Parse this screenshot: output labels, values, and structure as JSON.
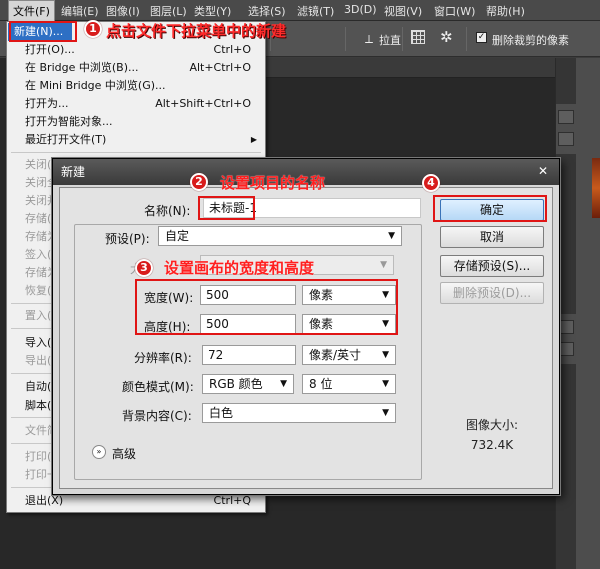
{
  "menubar": {
    "items": [
      "文件(F)",
      "编辑(E)",
      "图像(I)",
      "图层(L)",
      "类型(Y)",
      "选择(S)",
      "滤镜(T)",
      "3D(D)",
      "视图(V)",
      "窗口(W)",
      "帮助(H)"
    ]
  },
  "optbar": {
    "straighten_label": "拉直",
    "delete_cropped_label": "删除裁剪的像素"
  },
  "file_menu": {
    "items": [
      {
        "label": "新建(N)...",
        "shortcut": "",
        "state": "highlight"
      },
      {
        "label": "打开(O)...",
        "shortcut": "Ctrl+O",
        "state": "normal"
      },
      {
        "label": "在 Bridge 中浏览(B)...",
        "shortcut": "Alt+Ctrl+O",
        "state": "normal"
      },
      {
        "label": "在 Mini Bridge 中浏览(G)...",
        "shortcut": "",
        "state": "normal"
      },
      {
        "label": "打开为...",
        "shortcut": "Alt+Shift+Ctrl+O",
        "state": "normal"
      },
      {
        "label": "打开为智能对象...",
        "shortcut": "",
        "state": "normal"
      },
      {
        "label": "最近打开文件(T)",
        "shortcut": "",
        "state": "submenu"
      },
      {
        "label": "关闭(",
        "shortcut": "",
        "state": "disabled"
      },
      {
        "label": "关闭全",
        "shortcut": "",
        "state": "disabled"
      },
      {
        "label": "关闭并",
        "shortcut": "",
        "state": "disabled"
      },
      {
        "label": "存储(",
        "shortcut": "",
        "state": "disabled"
      },
      {
        "label": "存储为",
        "shortcut": "",
        "state": "disabled"
      },
      {
        "label": "签入(",
        "shortcut": "",
        "state": "disabled"
      },
      {
        "label": "存储为",
        "shortcut": "",
        "state": "disabled"
      },
      {
        "label": "恢复(",
        "shortcut": "",
        "state": "disabled"
      },
      {
        "label": "置入(",
        "shortcut": "",
        "state": "disabled"
      },
      {
        "label": "导入(",
        "shortcut": "",
        "state": "normal"
      },
      {
        "label": "导出(",
        "shortcut": "",
        "state": "disabled"
      },
      {
        "label": "自动(",
        "shortcut": "",
        "state": "normal"
      },
      {
        "label": "脚本(",
        "shortcut": "",
        "state": "normal"
      },
      {
        "label": "文件简",
        "shortcut": "",
        "state": "disabled"
      },
      {
        "label": "打印(",
        "shortcut": "",
        "state": "disabled"
      },
      {
        "label": "打印一",
        "shortcut": "",
        "state": "disabled"
      },
      {
        "label": "退出(X)",
        "shortcut": "Ctrl+Q",
        "state": "normal"
      }
    ]
  },
  "annotations": {
    "step1": {
      "num": "1",
      "text": "点击文件下拉菜单中的新建"
    },
    "step2": {
      "num": "2",
      "text": "设置项目的名称"
    },
    "step3": {
      "num": "3",
      "text": "设置画布的宽度和高度"
    },
    "step4": {
      "num": "4"
    }
  },
  "dialog": {
    "title": "新建",
    "close": "✕",
    "name_label": "名称(N):",
    "name_value": "未标题-1",
    "preset_label": "预设(P):",
    "preset_value": "自定",
    "size_label_partial": "大",
    "width_label": "宽度(W):",
    "width_value": "500",
    "width_unit": "像素",
    "height_label": "高度(H):",
    "height_value": "500",
    "height_unit": "像素",
    "resolution_label": "分辨率(R):",
    "resolution_value": "72",
    "resolution_unit": "像素/英寸",
    "color_mode_label": "颜色模式(M):",
    "color_mode_value": "RGB 颜色",
    "bit_depth_value": "8 位",
    "background_label": "背景内容(C):",
    "background_value": "白色",
    "advanced_label": "高级",
    "image_size_label": "图像大小:",
    "image_size_value": "732.4K",
    "ok_button": "确定",
    "cancel_button": "取消",
    "save_preset_button": "存储预设(S)...",
    "delete_preset_button": "删除预设(D)..."
  },
  "colors": {
    "accent_red": "#e01515",
    "menu_highlight": "#2d6fc4"
  }
}
